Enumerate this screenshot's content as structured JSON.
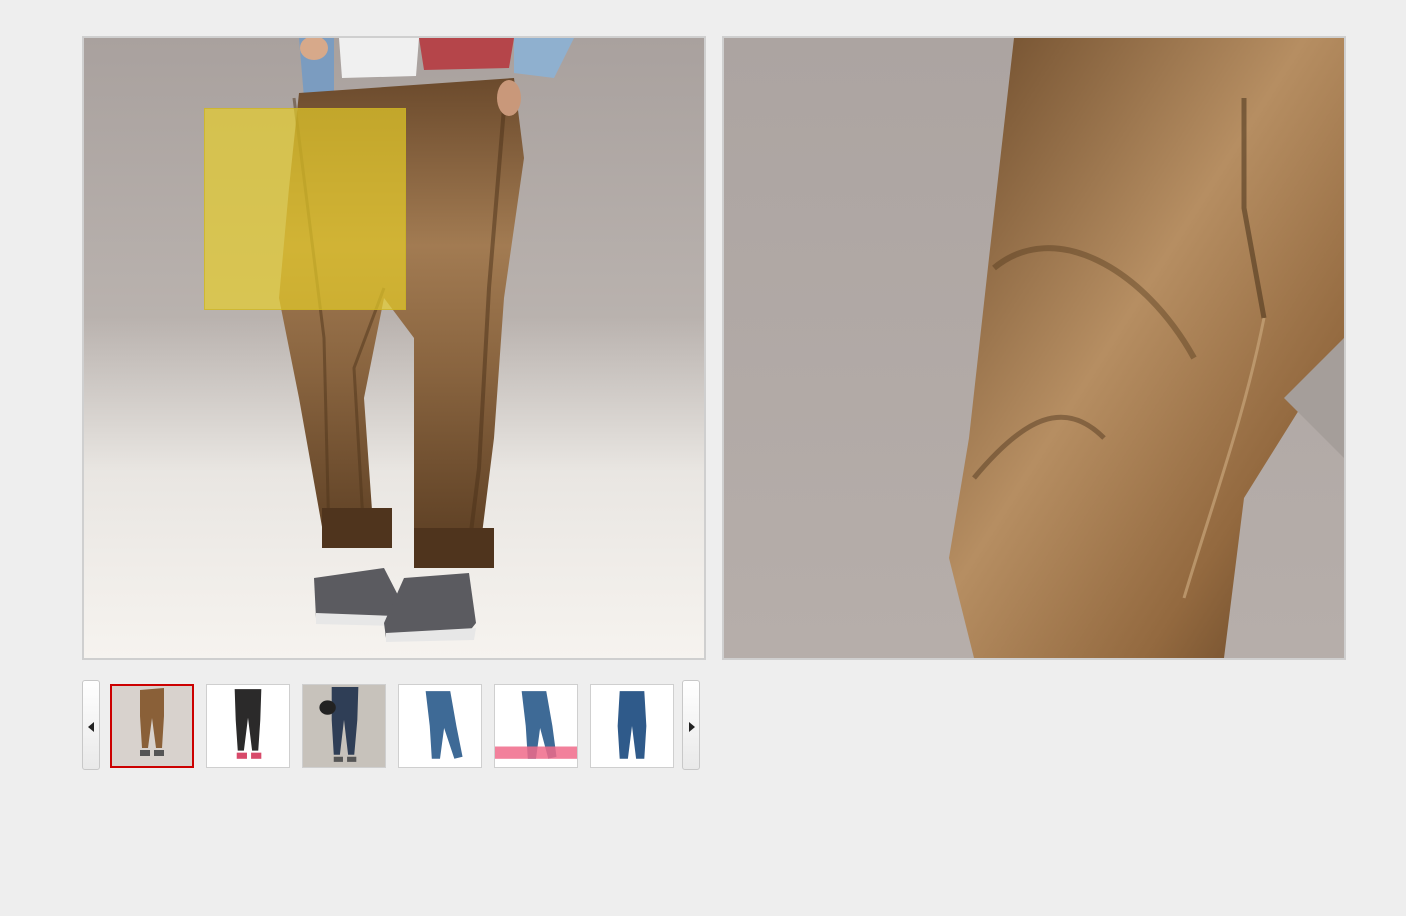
{
  "gallery": {
    "selected_index": 0,
    "thumbnails": [
      {
        "label": "brown-washed-jeans",
        "selected": true
      },
      {
        "label": "black-jeans",
        "selected": false
      },
      {
        "label": "dark-jeans-with-bag",
        "selected": false
      },
      {
        "label": "blue-jeans-flat",
        "selected": false
      },
      {
        "label": "blue-jeans-flat-banner",
        "selected": false
      },
      {
        "label": "blue-jeans-flat-2",
        "selected": false
      }
    ],
    "banner_text": "",
    "colors": {
      "lens": "#e8ce28",
      "selected_border": "#cc0000",
      "brown_denim": "#8a6038",
      "blue_denim": "#3e6a96"
    }
  },
  "controls": {
    "prev_icon": "triangle-left-icon",
    "next_icon": "triangle-right-icon"
  }
}
